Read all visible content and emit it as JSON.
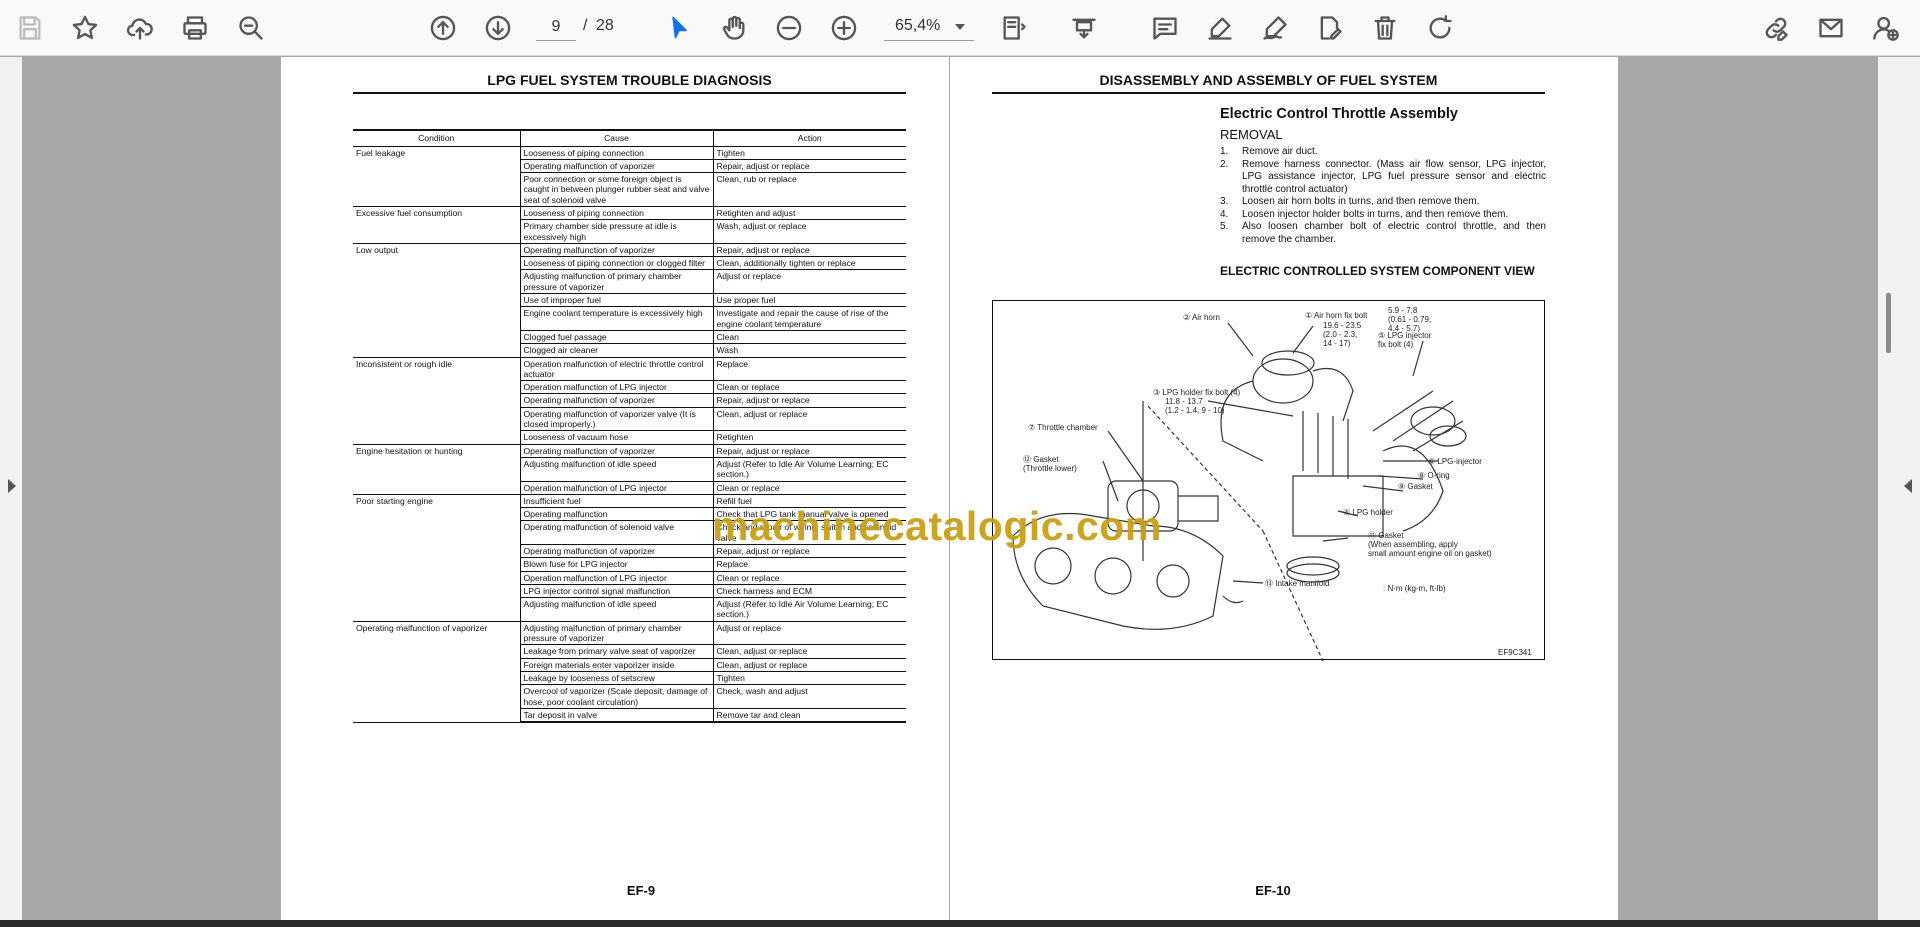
{
  "toolbar": {
    "icons": [
      "save-icon",
      "bookmark-star-icon",
      "upload-cloud-icon",
      "print-icon",
      "zoom-search-icon",
      "previous-page-icon",
      "next-page-icon",
      "select-pointer-icon",
      "hand-pan-icon",
      "zoom-out-icon",
      "zoom-in-icon",
      "fit-page-icon",
      "scroll-mode-icon",
      "comment-icon",
      "highlight-pen-icon",
      "sign-pen-icon",
      "edit-document-icon",
      "delete-icon",
      "rotate-icon",
      "link-edit-icon",
      "email-icon",
      "user-add-icon"
    ],
    "page_current": "9",
    "page_separator": "/",
    "page_total": "28",
    "zoom": "65,4%",
    "accent_color": "#1473e6"
  },
  "left_page": {
    "title": "LPG FUEL SYSTEM TROUBLE DIAGNOSIS",
    "page_number": "EF-9",
    "table": {
      "headers": [
        "Condition",
        "Cause",
        "Action"
      ],
      "rows": [
        {
          "condition": "Fuel leakage",
          "cause": "Looseness of piping connection",
          "action": "Tighten"
        },
        {
          "condition": "",
          "cause": "Operating malfunction of vaporizer",
          "action": "Repair, adjust or replace"
        },
        {
          "condition": "",
          "cause": "Poor connection or some foreign object is caught in between plunger rubber seat and valve seat of solenoid valve",
          "action": "Clean, rub or replace"
        },
        {
          "condition": "Excessive fuel consumption",
          "cause": "Looseness of piping connection",
          "action": "Retighten and adjust"
        },
        {
          "condition": "",
          "cause": "Primary chamber side pressure at idle is excessively high",
          "action": "Wash, adjust or replace"
        },
        {
          "condition": "Low output",
          "cause": "Operating malfunction of vaporizer",
          "action": "Repair, adjust or replace"
        },
        {
          "condition": "",
          "cause": "Looseness of piping connection or clogged filter",
          "action": "Clean, additionally tighten or replace"
        },
        {
          "condition": "",
          "cause": "Adjusting malfunction of primary chamber pressure of vaporizer",
          "action": "Adjust or replace"
        },
        {
          "condition": "",
          "cause": "Use of improper fuel",
          "action": "Use proper fuel"
        },
        {
          "condition": "",
          "cause": "Engine coolant temperature is excessively high",
          "action": "Investigate and repair the cause of rise of the engine coolant temperature"
        },
        {
          "condition": "",
          "cause": "Clogged fuel passage",
          "action": "Clean"
        },
        {
          "condition": "",
          "cause": "Clogged air cleaner",
          "action": "Wash"
        },
        {
          "condition": "Inconsistent or rough idle",
          "cause": "Operation malfunction of electric throttle control actuator",
          "action": "Replace"
        },
        {
          "condition": "",
          "cause": "Operation malfunction of LPG injector",
          "action": "Clean or replace"
        },
        {
          "condition": "",
          "cause": "Operating malfunction of vaporizer",
          "action": "Repair, adjust or replace"
        },
        {
          "condition": "",
          "cause": "Operating malfunction of vaporizer valve (It is closed improperly.)",
          "action": "Clean, adjust or replace"
        },
        {
          "condition": "",
          "cause": "Looseness of vacuum hose",
          "action": "Retighten"
        },
        {
          "condition": "Engine hesitation or hunting",
          "cause": "Operating malfunction of vaporizer",
          "action": "Repair, adjust or replace"
        },
        {
          "condition": "",
          "cause": "Adjusting malfunction of idle speed",
          "action": "Adjust (Refer to Idle Air Volume Learning; EC section.)"
        },
        {
          "condition": "",
          "cause": "Operation malfunction of LPG injector",
          "action": "Clean or replace"
        },
        {
          "condition": "Poor starting engine",
          "cause": "Insufficient fuel",
          "action": "Refill fuel"
        },
        {
          "condition": "",
          "cause": "Operating malfunction",
          "action": "Check that LPG tank manual valve is opened"
        },
        {
          "condition": "",
          "cause": "Operating malfunction of solenoid valve",
          "action": "Check and repair of wiring, switch and solenoid valve"
        },
        {
          "condition": "",
          "cause": "Operating malfunction of vaporizer",
          "action": "Repair, adjust or replace"
        },
        {
          "condition": "",
          "cause": "Blown fuse for LPG injector",
          "action": "Replace"
        },
        {
          "condition": "",
          "cause": "Operation malfunction of LPG injector",
          "action": "Clean or replace"
        },
        {
          "condition": "",
          "cause": "LPG injector control signal malfunction",
          "action": "Check harness and ECM"
        },
        {
          "condition": "",
          "cause": "Adjusting malfunction of idle speed",
          "action": "Adjust (Refer to Idle Air Volume Learning; EC section.)"
        },
        {
          "condition": "Operating malfunction of vaporizer",
          "cause": "Adjusting malfunction of primary chamber pressure of vaporizer",
          "action": "Adjust or replace"
        },
        {
          "condition": "",
          "cause": "Leakage from primary valve seat of vaporizer",
          "action": "Clean, adjust or replace"
        },
        {
          "condition": "",
          "cause": "Foreign materials enter vaporizer inside",
          "action": "Clean, adjust or replace"
        },
        {
          "condition": "",
          "cause": "Leakage by looseness of setscrew",
          "action": "Tighten"
        },
        {
          "condition": "",
          "cause": "Overcool of vaporizer (Scale deposit, damage of hose, poor coolant circulation)",
          "action": "Check, wash and adjust"
        },
        {
          "condition": "",
          "cause": "Tar deposit in valve",
          "action": "Remove tar and clean"
        }
      ]
    }
  },
  "right_page": {
    "title": "DISASSEMBLY AND ASSEMBLY OF FUEL SYSTEM",
    "page_number": "EF-10",
    "section_title": "Electric Control Throttle Assembly",
    "subsection_title": "REMOVAL",
    "steps": [
      {
        "num": "1.",
        "text": "Remove air duct."
      },
      {
        "num": "2.",
        "text": "Remove harness connector. (Mass air flow sensor, LPG injector, LPG assistance injector, LPG fuel pressure sensor and electric throttle control actuator)"
      },
      {
        "num": "3.",
        "text": "Loosen air horn bolts in turns, and then remove them."
      },
      {
        "num": "4.",
        "text": "Loosen injector holder bolts in turns, and then remove them."
      },
      {
        "num": "5.",
        "text": "Also loosen chamber bolt of electric control throttle, and then remove the chamber."
      }
    ],
    "component_view_title": "ELECTRIC CONTROLLED SYSTEM COMPONENT VIEW",
    "diagram_labels": {
      "air_horn": "② Air horn",
      "air_horn_fix_bolt": "① Air horn fix bolt",
      "air_horn_torque": "19.6 - 23.5\n(2.0 - 2.3,\n14 - 17)",
      "lpg_holder_fix_bolt_torque": "5.9 - 7.8\n(0.61 - 0.79,\n4.4 - 5.7)",
      "lpg_injector_fix_bolt": "⑤ LPG injector\nfix bolt (4)",
      "lpg_holder_fix_bolt": "③ LPG holder fix bolt (4)",
      "lpg_holder_fix_bolt_torque_2": "11.8 - 13.7\n(1.2 - 1.4, 9 - 10)",
      "throttle_chamber": "⑦ Throttle chamber",
      "gasket_throttle": "⑫ Gasket\n(Throttle lower)",
      "lpg_injector": "⑥ LPG-injector",
      "o_ring": "⑧ O-ring",
      "gasket": "⑨ Gasket",
      "lpg_holder": "④ LPG holder",
      "gasket_note": "⑪ Gasket\n(When assembling, apply\nsmall amount engine oil on gasket)",
      "intake_manifold": "⑬ Intake manifold",
      "units": ": N·m (kg-m, ft-lb)",
      "figure_code": "EF9C341"
    },
    "watermark": "machinecatalogic.com"
  },
  "colors": {
    "viewer_background": "#a8a8a8",
    "toolbar_background": "#f9f9f9",
    "watermark": "#c8a017"
  }
}
